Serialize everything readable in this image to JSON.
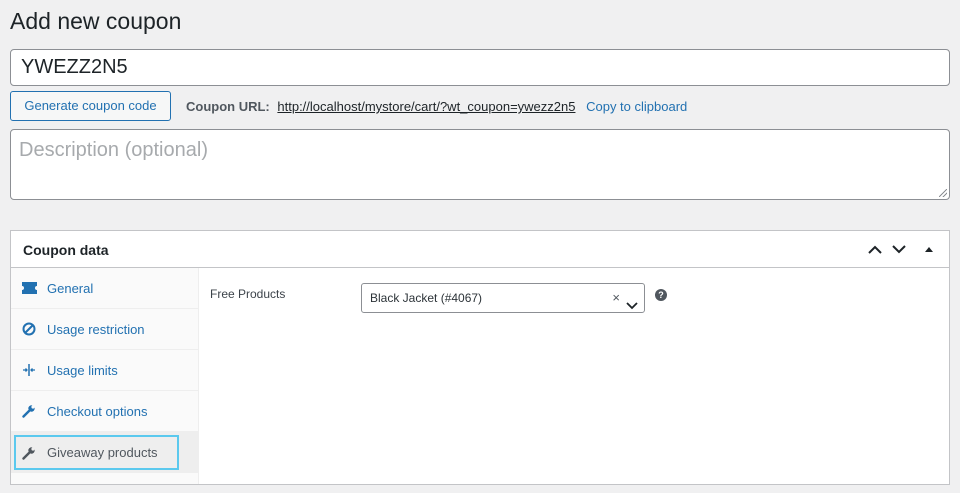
{
  "page": {
    "title": "Add new coupon"
  },
  "coupon": {
    "code": "YWEZZ2N5",
    "generate_label": "Generate coupon code",
    "url_label": "Coupon URL:",
    "url": "http://localhost/mystore/cart/?wt_coupon=ywezz2n5",
    "copy_label": "Copy to clipboard",
    "description_placeholder": "Description (optional)"
  },
  "panel": {
    "title": "Coupon data",
    "tabs": [
      {
        "label": "General",
        "icon": "ticket-icon"
      },
      {
        "label": "Usage restriction",
        "icon": "block-icon"
      },
      {
        "label": "Usage limits",
        "icon": "limits-icon"
      },
      {
        "label": "Checkout options",
        "icon": "wrench-icon"
      },
      {
        "label": "Giveaway products",
        "icon": "wrench-icon",
        "active": true
      }
    ],
    "free_products": {
      "label": "Free Products",
      "selected": "Black Jacket (#4067)",
      "clear": "×",
      "help": "?"
    }
  },
  "colors": {
    "accent": "#2271b1",
    "focus": "#5bc9ee"
  }
}
